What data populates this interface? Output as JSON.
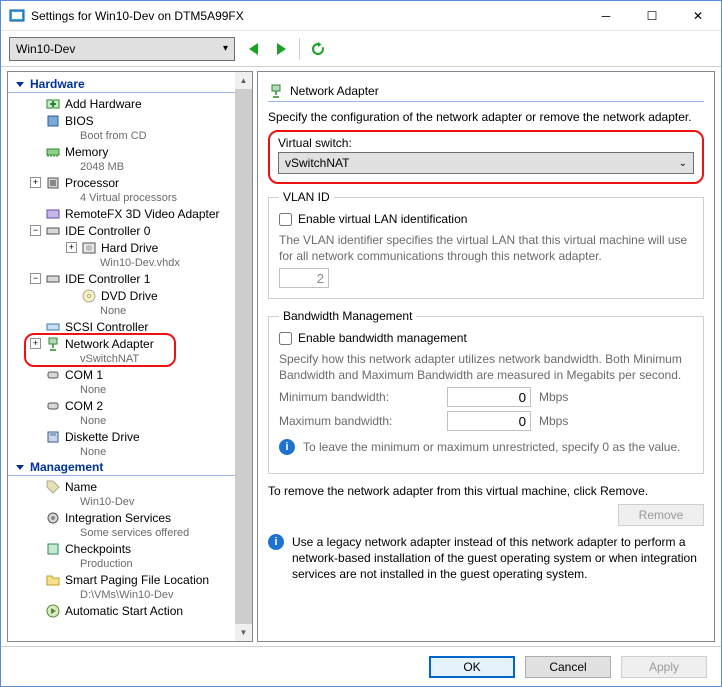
{
  "title": "Settings for Win10-Dev on DTM5A99FX",
  "vm_selector": "Win10-Dev",
  "sections": {
    "hardware": "Hardware",
    "management": "Management"
  },
  "tree": {
    "add_hardware": "Add Hardware",
    "bios": "BIOS",
    "bios_sub": "Boot from CD",
    "memory": "Memory",
    "memory_sub": "2048 MB",
    "processor": "Processor",
    "processor_sub": "4 Virtual processors",
    "remotefx": "RemoteFX 3D Video Adapter",
    "ide0": "IDE Controller 0",
    "hard_drive": "Hard Drive",
    "hard_drive_sub": "Win10-Dev.vhdx",
    "ide1": "IDE Controller 1",
    "dvd": "DVD Drive",
    "dvd_sub": "None",
    "scsi": "SCSI Controller",
    "net": "Network Adapter",
    "net_sub": "vSwitchNAT",
    "com1": "COM 1",
    "com1_sub": "None",
    "com2": "COM 2",
    "com2_sub": "None",
    "diskette": "Diskette Drive",
    "diskette_sub": "None",
    "name": "Name",
    "name_sub": "Win10-Dev",
    "integration": "Integration Services",
    "integration_sub": "Some services offered",
    "checkpoints": "Checkpoints",
    "checkpoints_sub": "Production",
    "paging": "Smart Paging File Location",
    "paging_sub": "D:\\VMs\\Win10-Dev",
    "autostart": "Automatic Start Action"
  },
  "panel": {
    "title": "Network Adapter",
    "desc": "Specify the configuration of the network adapter or remove the network adapter.",
    "vswitch_label": "Virtual switch:",
    "vswitch_value": "vSwitchNAT",
    "vlan": {
      "legend": "VLAN ID",
      "enable": "Enable virtual LAN identification",
      "hint": "The VLAN identifier specifies the virtual LAN that this virtual machine will use for all network communications through this network adapter.",
      "value": "2"
    },
    "bw": {
      "legend": "Bandwidth Management",
      "enable": "Enable bandwidth management",
      "hint1": "Specify how this network adapter utilizes network bandwidth. Both Minimum Bandwidth and Maximum Bandwidth are measured in Megabits per second.",
      "min_label": "Minimum bandwidth:",
      "min_value": "0",
      "max_label": "Maximum bandwidth:",
      "max_value": "0",
      "unit": "Mbps",
      "hint2": "To leave the minimum or maximum unrestricted, specify 0 as the value."
    },
    "remove_hint": "To remove the network adapter from this virtual machine, click Remove.",
    "remove_btn": "Remove",
    "legacy_info": "Use a legacy network adapter instead of this network adapter to perform a network-based installation of the guest operating system or when integration services are not installed in the guest operating system."
  },
  "footer": {
    "ok": "OK",
    "cancel": "Cancel",
    "apply": "Apply"
  }
}
